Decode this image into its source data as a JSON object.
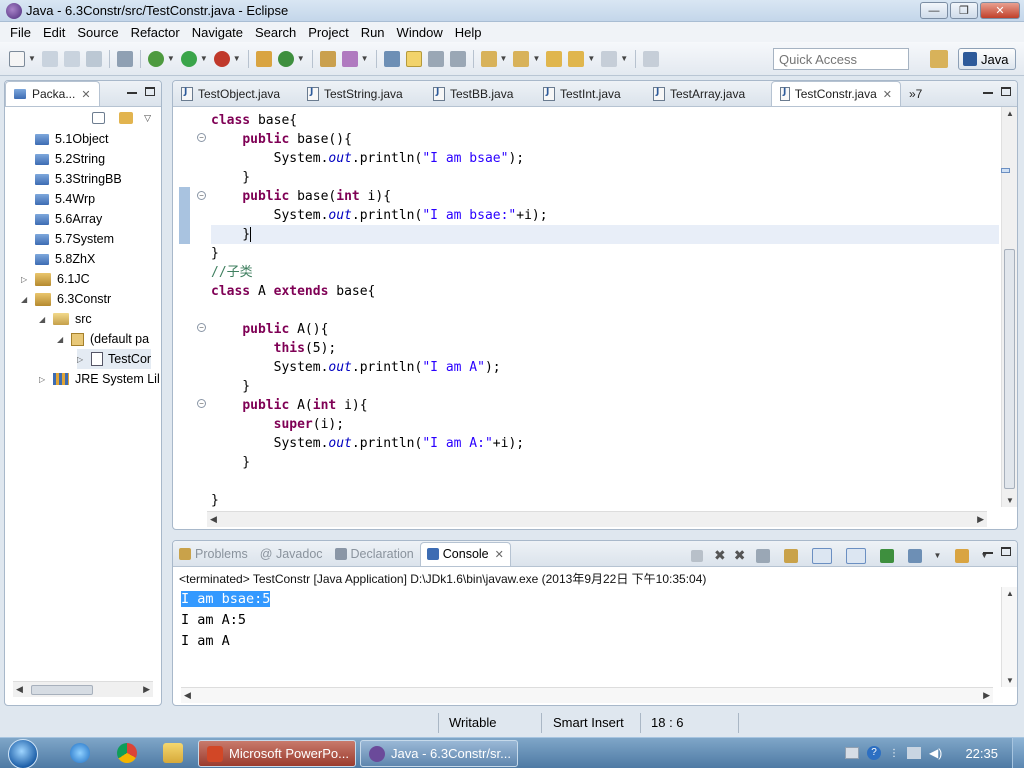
{
  "window": {
    "title": "Java - 6.3Constr/src/TestConstr.java - Eclipse",
    "min_glyph": "—",
    "max_glyph": "❐",
    "close_glyph": "✕"
  },
  "menu": [
    "File",
    "Edit",
    "Source",
    "Refactor",
    "Navigate",
    "Search",
    "Project",
    "Run",
    "Window",
    "Help"
  ],
  "toolbar": {
    "quick_access_placeholder": "Quick Access",
    "perspective_label": "Java"
  },
  "package_explorer": {
    "tab_label": "Packa...",
    "tree": [
      {
        "label": "5.1Object",
        "kind": "folder"
      },
      {
        "label": "5.2String",
        "kind": "folder"
      },
      {
        "label": "5.3StringBB",
        "kind": "folder"
      },
      {
        "label": "5.4Wrp",
        "kind": "folder"
      },
      {
        "label": "5.6Array",
        "kind": "folder"
      },
      {
        "label": "5.7System",
        "kind": "folder"
      },
      {
        "label": "5.8ZhX",
        "kind": "folder"
      },
      {
        "label": "6.1JC",
        "kind": "project",
        "arrow": "▷"
      },
      {
        "label": "6.3Constr",
        "kind": "project",
        "arrow": "◢"
      },
      {
        "label": "src",
        "kind": "src",
        "arrow": "◢"
      },
      {
        "label": "(default pa",
        "kind": "package",
        "arrow": "◢"
      },
      {
        "label": "TestCor",
        "kind": "java",
        "arrow": "▷"
      },
      {
        "label": "JRE System Lil",
        "kind": "library",
        "arrow": "▷"
      }
    ]
  },
  "editor": {
    "tabs": [
      {
        "label": "TestObject.java"
      },
      {
        "label": "TestString.java"
      },
      {
        "label": "TestBB.java"
      },
      {
        "label": "TestInt.java"
      },
      {
        "label": "TestArray.java"
      },
      {
        "label": "TestConstr.java",
        "active": true
      }
    ],
    "overflow_label": "»7",
    "code": [
      "class base{",
      "    public base(){",
      "        System.out.println(\"I am bsae\");",
      "    }",
      "    public base(int i){",
      "        System.out.println(\"I am bsae:\"+i);",
      "    }",
      "}",
      "//子类",
      "class A extends base{",
      "",
      "    public A(){",
      "        this(5);",
      "        System.out.println(\"I am A\");",
      "    }",
      "    public A(int i){",
      "        super(i);",
      "        System.out.println(\"I am A:\"+i);",
      "    }",
      "",
      "}"
    ]
  },
  "console": {
    "tabs": [
      {
        "label": "Problems",
        "icon_color": "#c9a24a"
      },
      {
        "label": "@ Javadoc",
        "icon_color": ""
      },
      {
        "label": "Declaration",
        "icon_color": "#8a96a6"
      },
      {
        "label": "Console",
        "icon_color": "#3d6cb3",
        "active": true
      }
    ],
    "status": "<terminated> TestConstr [Java Application] D:\\JDk1.6\\bin\\javaw.exe (2013年9月22日 下午10:35:04)",
    "output": [
      "I am bsae:5",
      "I am A:5",
      "I am A"
    ]
  },
  "statusbar": {
    "writable": "Writable",
    "insert_mode": "Smart Insert",
    "position": "18 : 6"
  },
  "taskbar": {
    "buttons": [
      {
        "label": "Microsoft PowerPo...",
        "icon_color": "#d24726"
      },
      {
        "label": "Java - 6.3Constr/sr...",
        "icon_color": "#6b4a9a"
      }
    ],
    "clock": "22:35"
  }
}
